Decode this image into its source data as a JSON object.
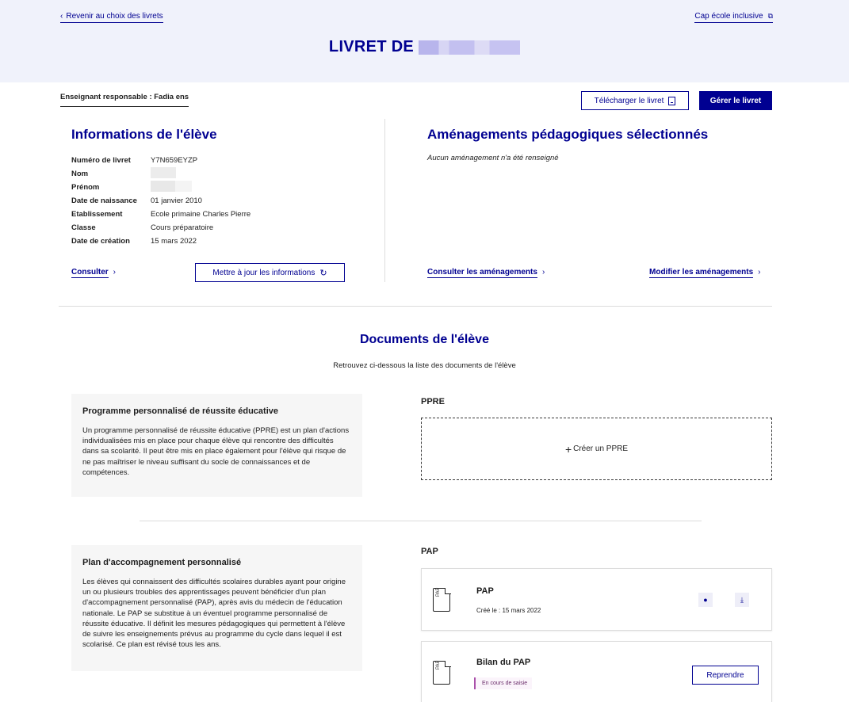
{
  "banner": {
    "back_label": "Revenir au choix des livrets",
    "cap_label": "Cap école inclusive",
    "title": "LIVRET DE"
  },
  "header": {
    "teacher": "Enseignant responsable : Fadia ens",
    "download_label": "Télécharger le livret",
    "manage_label": "Gérer le livret"
  },
  "student_info": {
    "title": "Informations de l'élève",
    "rows": [
      {
        "label": "Numéro de livret",
        "value": "Y7N659EYZP"
      },
      {
        "label": "Nom",
        "value": ""
      },
      {
        "label": "Prénom",
        "value": ""
      },
      {
        "label": "Date de naissance",
        "value": "01 janvier 2010"
      },
      {
        "label": "Etablissement",
        "value": "Ecole primaine Charles Pierre"
      },
      {
        "label": "Classe",
        "value": "Cours préparatoire"
      },
      {
        "label": "Date de création",
        "value": "15 mars 2022"
      }
    ],
    "consult_label": "Consulter",
    "update_label": "Mettre à jour les informations"
  },
  "amenagements": {
    "title": "Aménagements pédagogiques sélectionnés",
    "empty_text": "Aucun aménagement n'a été renseigné",
    "consult_label": "Consulter les aménagements",
    "modify_label": "Modifier les aménagements"
  },
  "documents": {
    "title": "Documents de l'élève",
    "subtitle": "Retrouvez ci-dessous la liste des documents de l'élève",
    "ppre": {
      "card_title": "Programme personnalisé de réussite éducative",
      "card_text": "Un programme personnalisé de réussite éducative (PPRE) est un plan d'actions individualisées mis en place pour chaque élève qui rencontre des difficultés dans sa scolarité. Il peut être mis en place également pour l'élève qui risque de ne pas maîtriser le niveau suffisant du socle de connaissances et de compétences.",
      "heading": "PPRE",
      "create_label": "Créer un PPRE"
    },
    "pap": {
      "card_title": "Plan d'accompagnement personnalisé",
      "card_text": "Les élèves qui connaissent des difficultés scolaires durables ayant pour origine un ou plusieurs troubles des apprentissages peuvent bénéficier d'un plan d'accompagnement personnalisé (PAP), après avis du médecin de l'éducation nationale. Le PAP se substitue à un éventuel programme personnalisé de réussite éducative. Il définit les mesures pédagogiques qui permettent à l'élève de suivre les enseignements prévus au programme du cycle dans lequel il est scolarisé. Ce plan est révisé tous les ans.",
      "heading": "PAP",
      "items": [
        {
          "icon_label": "PAP",
          "name": "PAP",
          "date": "Créé le : 15 mars 2022"
        },
        {
          "icon_label": "PAP",
          "name": "Bilan du PAP",
          "status": "En cours de saisie",
          "resume_label": "Reprendre"
        }
      ]
    }
  },
  "icons": {
    "back": "chevron-left-icon",
    "external": "external-link-icon",
    "download_doc": "document-download-icon",
    "refresh": "refresh-icon",
    "chevron_right": "chevron-right-icon",
    "plus": "plus-icon",
    "eye": "eye-icon",
    "download": "download-icon",
    "file": "file-icon"
  },
  "colors": {
    "primary": "#000091",
    "banner_bg": "#f0f2fb",
    "card_bg": "#f6f6f6",
    "status": "#a94fa9"
  }
}
